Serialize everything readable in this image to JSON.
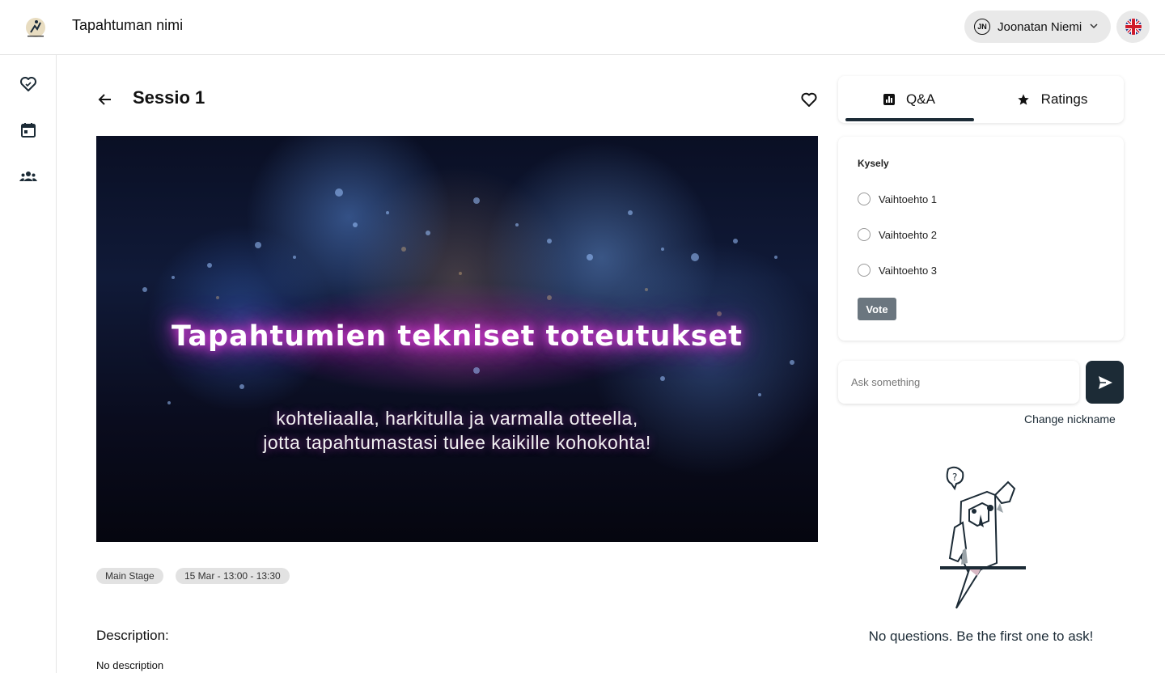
{
  "header": {
    "event_title": "Tapahtuman nimi",
    "user": {
      "initials": "JN",
      "name": "Joonatan Niemi"
    },
    "language_icon": "uk-flag-icon"
  },
  "sidebar": {
    "items": [
      {
        "icon": "heart-icon"
      },
      {
        "icon": "calendar-icon"
      },
      {
        "icon": "people-icon"
      }
    ]
  },
  "session": {
    "title": "Sessio 1",
    "hero": {
      "headline": "Tapahtumien tekniset toteutukset",
      "subline1": "kohteliaalla, harkitulla ja varmalla otteella,",
      "subline2": "jotta tapahtumastasi tulee kaikille kohokohta!"
    },
    "tags": [
      "Main Stage",
      "15 Mar - 13:00 - 13:30"
    ],
    "description_heading": "Description:",
    "description_text": "No description"
  },
  "panel": {
    "tabs": [
      {
        "label": "Q&A",
        "icon": "chart-icon",
        "active": true
      },
      {
        "label": "Ratings",
        "icon": "star-icon",
        "active": false
      }
    ],
    "poll": {
      "title": "Kysely",
      "options": [
        "Vaihtoehto 1",
        "Vaihtoehto 2",
        "Vaihtoehto 3"
      ],
      "vote_label": "Vote"
    },
    "ask_placeholder": "Ask something",
    "change_nickname": "Change nickname",
    "empty_message": "No questions. Be the first one to ask!"
  },
  "colors": {
    "accent": "#1c2b36",
    "vote_button": "#6b767f",
    "chip_bg": "#e9e9e9"
  }
}
